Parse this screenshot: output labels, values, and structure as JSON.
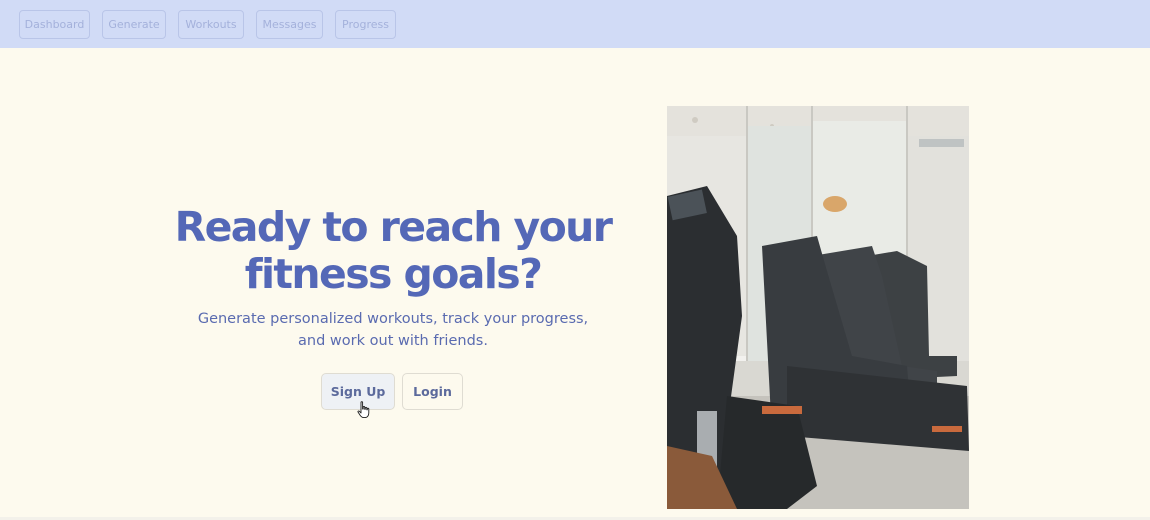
{
  "nav": {
    "items": [
      {
        "label": "Dashboard"
      },
      {
        "label": "Generate"
      },
      {
        "label": "Workouts"
      },
      {
        "label": "Messages"
      },
      {
        "label": "Progress"
      }
    ]
  },
  "hero": {
    "title_line1": "Ready to reach your",
    "title_line2": "fitness goals?",
    "subtitle_line1": "Generate personalized workouts, track your progress,",
    "subtitle_line2": "and work out with friends.",
    "signup_label": "Sign Up",
    "login_label": "Login"
  },
  "colors": {
    "nav_bg": "#d1dbf6",
    "page_bg": "#fdfaee",
    "accent": "#5468b7"
  },
  "icons": {
    "cursor": "hand-pointer-icon"
  }
}
